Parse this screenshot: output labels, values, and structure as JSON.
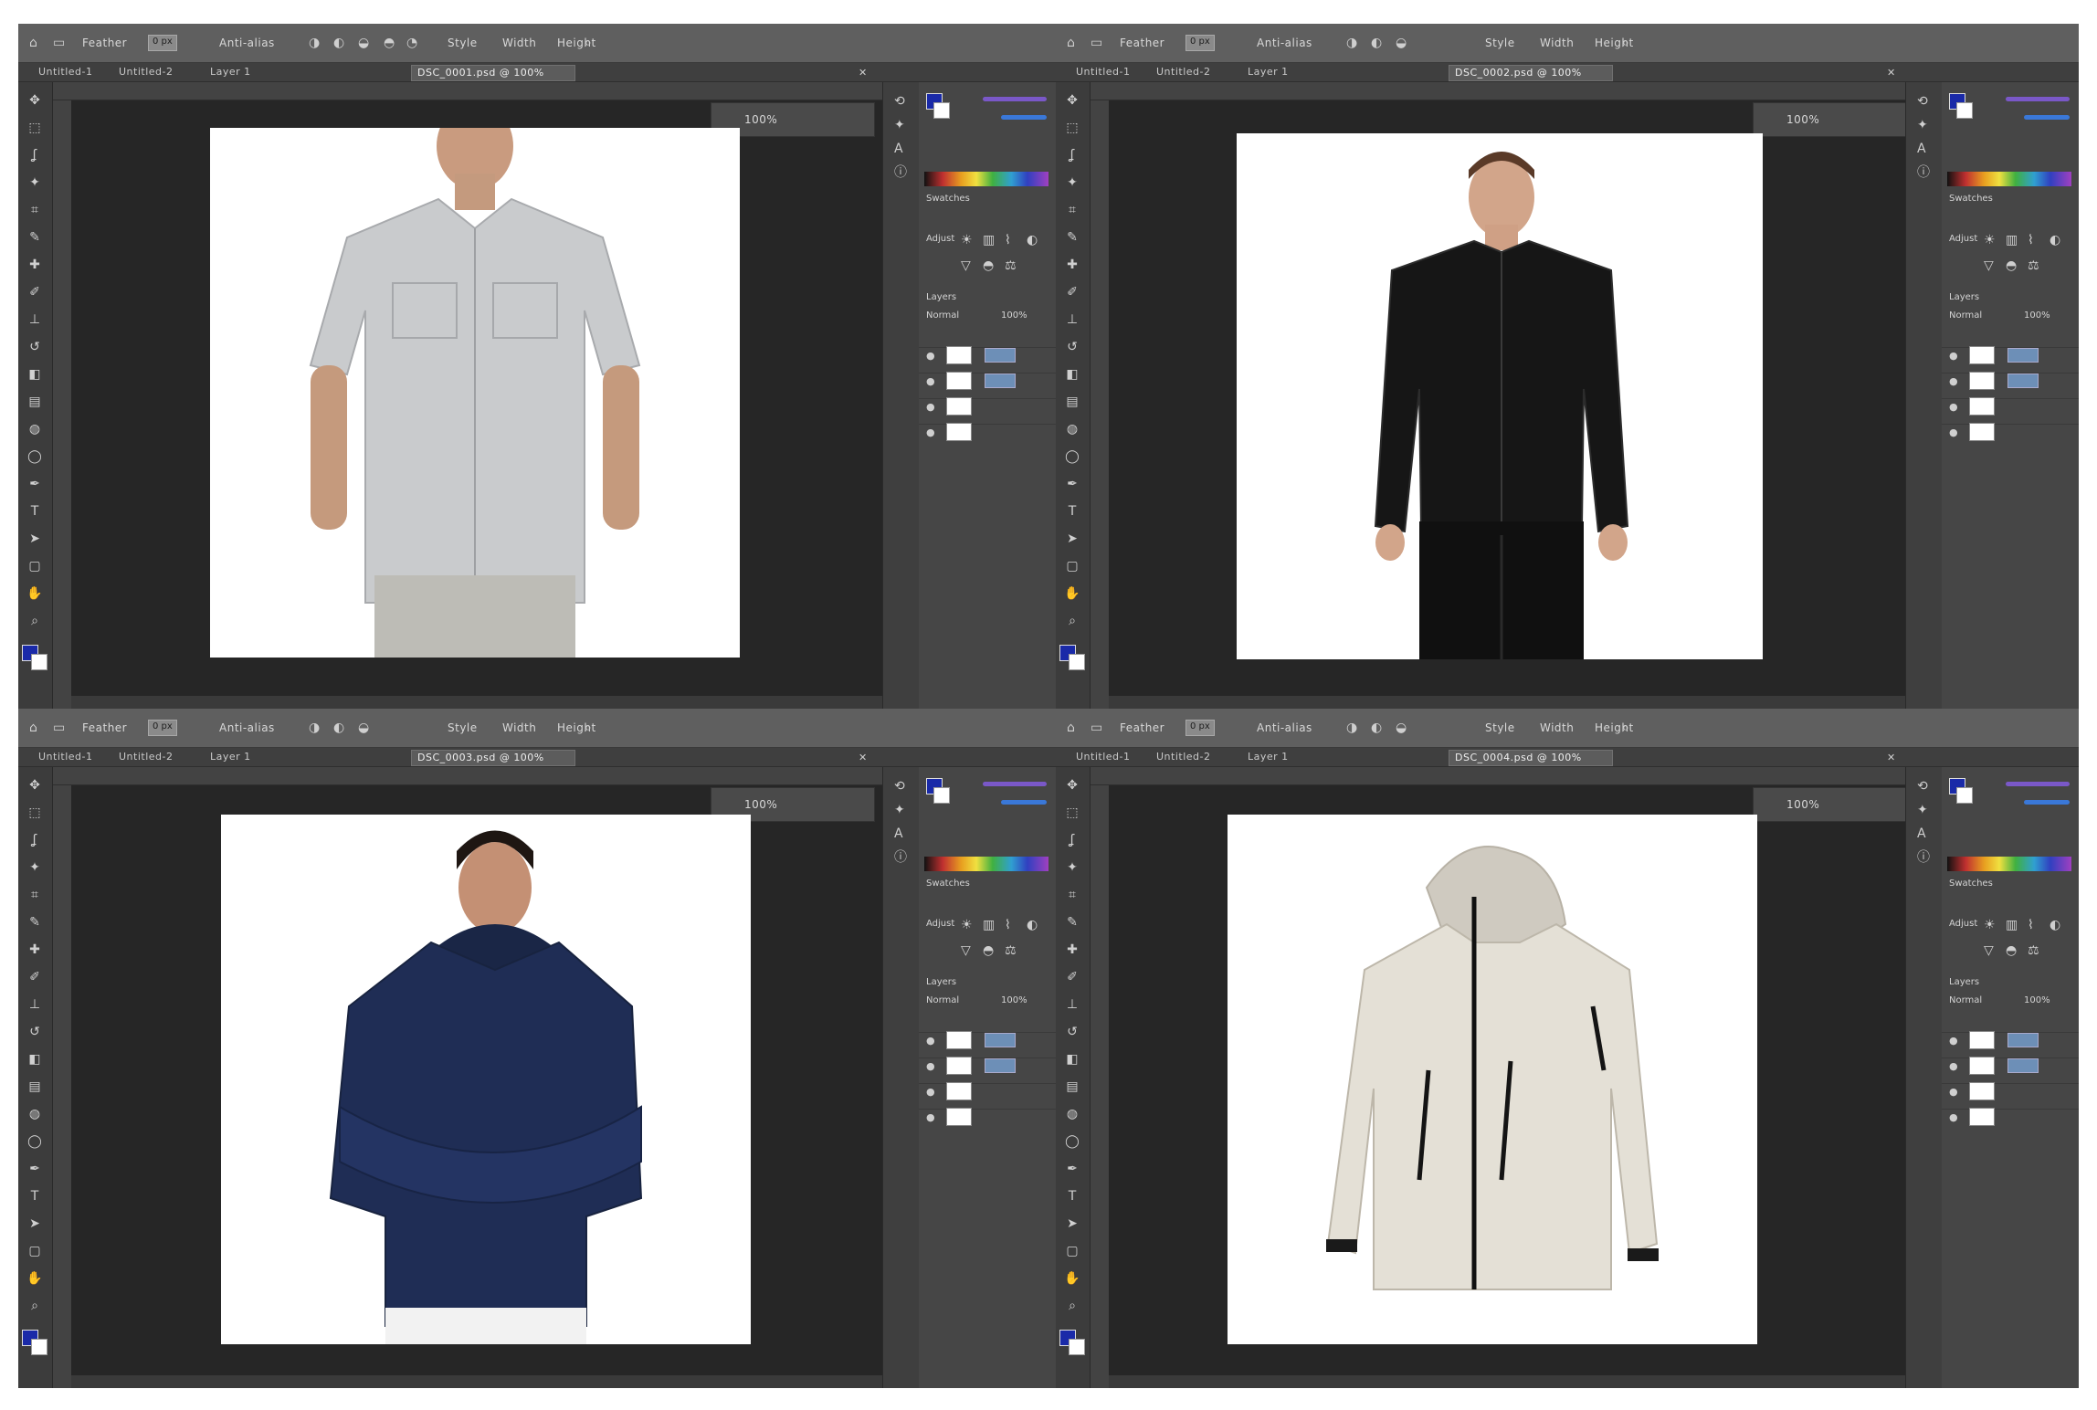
{
  "windows": [
    {
      "options": [
        "Feather",
        "Anti-alias",
        "Style",
        "Width",
        "Height"
      ],
      "tab_active": "DSC_0001.psd @ 100%",
      "tabs_other": [
        "Untitled-1",
        "Untitled-2",
        "Layer 1"
      ],
      "nav_label": "100%",
      "subject": "shirt"
    },
    {
      "options": [
        "Feather",
        "Anti-alias",
        "Style",
        "Width",
        "Height"
      ],
      "tab_active": "DSC_0002.psd @ 100%",
      "tabs_other": [
        "Untitled-1",
        "Untitled-2",
        "Layer 1"
      ],
      "nav_label": "100%",
      "subject": "track-jacket"
    },
    {
      "options": [
        "Feather",
        "Anti-alias",
        "Style",
        "Width",
        "Height"
      ],
      "tab_active": "DSC_0003.psd @ 100%",
      "tabs_other": [
        "Untitled-1",
        "Untitled-2",
        "Layer 1"
      ],
      "nav_label": "100%",
      "subject": "hoodie"
    },
    {
      "options": [
        "Feather",
        "Anti-alias",
        "Style",
        "Width",
        "Height"
      ],
      "tab_active": "DSC_0004.psd @ 100%",
      "tabs_other": [
        "Untitled-1",
        "Untitled-2",
        "Layer 1"
      ],
      "nav_label": "100%",
      "subject": "shell-jacket"
    }
  ],
  "panels": {
    "swatches_label": "Swatches",
    "adjust_label": "Adjust",
    "layers_label": "Layers",
    "normal_label": "Normal",
    "opacity_label": "100%"
  },
  "colors": {
    "shirt": "#c9cbcd",
    "track_jacket": "#161616",
    "hoodie": "#1f2d55",
    "shell_jacket": "#e4e0d6",
    "foreground": "#1a2aa8"
  }
}
